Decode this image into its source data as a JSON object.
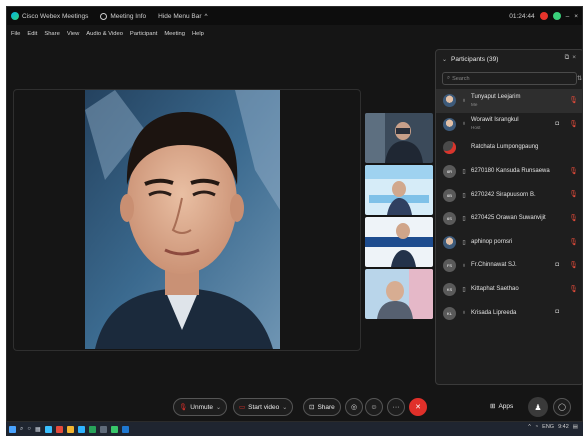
{
  "titlebar": {
    "app_title": "Cisco Webex Meetings",
    "meeting_info": "Meeting Info",
    "hide_menu": "Hide Menu Bar",
    "hide_menu_chevron": "^",
    "timer": "01:24:44",
    "minimize": "–",
    "close": "×"
  },
  "menu": [
    "File",
    "Edit",
    "Share",
    "View",
    "Audio & Video",
    "Participant",
    "Meeting",
    "Help"
  ],
  "participants_panel": {
    "title": "Participants (39)",
    "search_placeholder": "Search",
    "participants": [
      {
        "name": "Tunyaput Leejarim",
        "role": "Me",
        "avatar": "photo",
        "status": "mic",
        "camera": false,
        "muted": true
      },
      {
        "name": "Worawit Israngkul",
        "role": "Host",
        "avatar": "photo",
        "status": "mic",
        "camera": true,
        "muted": true
      },
      {
        "name": "Ratchata Lumpongpaung",
        "role": "",
        "avatar": "red",
        "status": "",
        "camera": false,
        "muted": false
      },
      {
        "name": "6270180 Kansuda Runsaewa",
        "role": "",
        "avatar": "6R",
        "status": "device",
        "camera": false,
        "muted": true
      },
      {
        "name": "6270242 Sirapuusorn B.",
        "role": "",
        "avatar": "6B",
        "status": "device",
        "camera": false,
        "muted": true
      },
      {
        "name": "6270425 Orawan Suwanvijit",
        "role": "",
        "avatar": "6S",
        "status": "device",
        "camera": false,
        "muted": true
      },
      {
        "name": "aphinop pornsri",
        "role": "",
        "avatar": "photo",
        "status": "device",
        "camera": false,
        "muted": true
      },
      {
        "name": "Fr.Chinnawat SJ.",
        "role": "",
        "avatar": "FS",
        "status": "mic",
        "camera": true,
        "muted": true
      },
      {
        "name": "Kittaphat Saethao",
        "role": "",
        "avatar": "KS",
        "status": "device",
        "camera": false,
        "muted": true
      },
      {
        "name": "Krisada Lipreeda",
        "role": "",
        "avatar": "KL",
        "status": "mic",
        "camera": true,
        "muted": false
      }
    ]
  },
  "controls": {
    "unmute_label": "Unmute",
    "start_video_label": "Start video",
    "share_label": "Share",
    "apps_label": "Apps",
    "more_label": "···"
  },
  "taskbar": {
    "tray_text": "ENG",
    "clock": "9:42"
  },
  "colors": {
    "accent_red": "#e0302a",
    "panel_bg": "#1e1e1e",
    "frame_bg": "#151515"
  }
}
